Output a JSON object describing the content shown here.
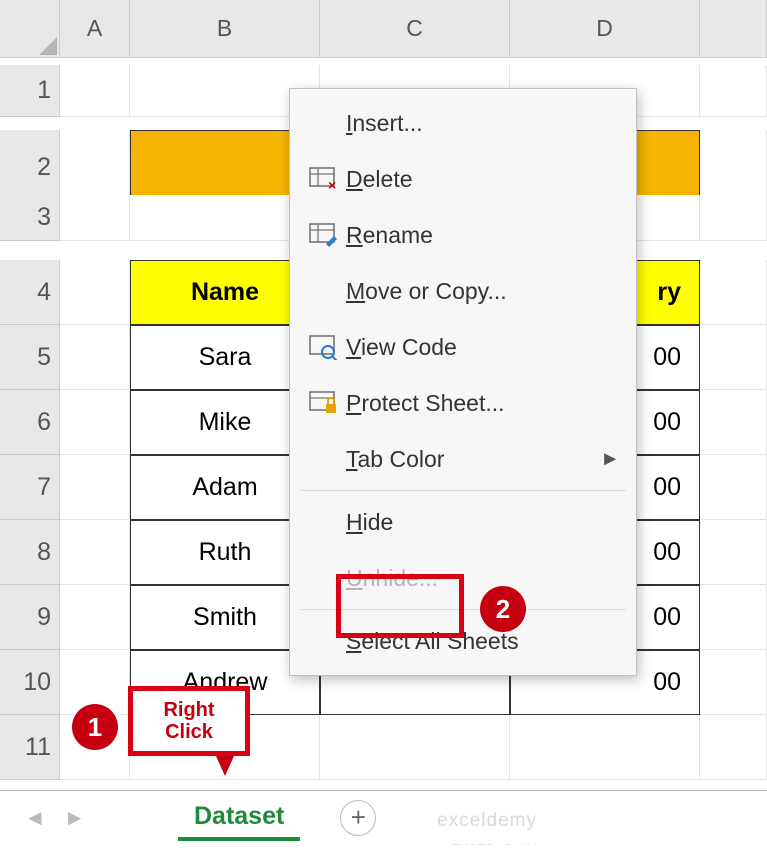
{
  "column_headers": [
    "A",
    "B",
    "C",
    "D",
    ""
  ],
  "row_headers": [
    "1",
    "2",
    "3",
    "4",
    "5",
    "6",
    "7",
    "8",
    "9",
    "10",
    "11"
  ],
  "table": {
    "header_left": "Name",
    "header_right_fragment": "ry",
    "rows": [
      {
        "name": "Sara",
        "val": "00"
      },
      {
        "name": "Mike",
        "val": "00"
      },
      {
        "name": "Adam",
        "val": "00"
      },
      {
        "name": "Ruth",
        "val": "00"
      },
      {
        "name": "Smith",
        "val": "00"
      },
      {
        "name": "Andrew",
        "val": "00"
      }
    ]
  },
  "context_menu": {
    "insert": "Insert...",
    "delete": "Delete",
    "rename": "Rename",
    "move_copy": "Move or Copy...",
    "view_code": "View Code",
    "protect": "Protect Sheet...",
    "tab_color": "Tab Color",
    "hide": "Hide",
    "unhide": "Unhide...",
    "select_all": "Select All Sheets"
  },
  "callouts": {
    "step1": "1",
    "step2": "2",
    "right_click": "Right\nClick"
  },
  "tabs": {
    "active": "Dataset"
  },
  "watermark": "exceldemy",
  "chart_data": {
    "type": "table",
    "note": "Excel worksheet with a table; columns C and part of D obscured by context menu",
    "visible_header_cells": [
      "Name",
      "(hidden)",
      "(hidden ending in 'ry')"
    ],
    "visible_rows": [
      [
        "Sara",
        "?",
        "?00"
      ],
      [
        "Mike",
        "?",
        "?00"
      ],
      [
        "Adam",
        "?",
        "?00"
      ],
      [
        "Ruth",
        "?",
        "?00"
      ],
      [
        "Smith",
        "?",
        "?00"
      ],
      [
        "Andrew",
        "?",
        "?00"
      ]
    ]
  }
}
